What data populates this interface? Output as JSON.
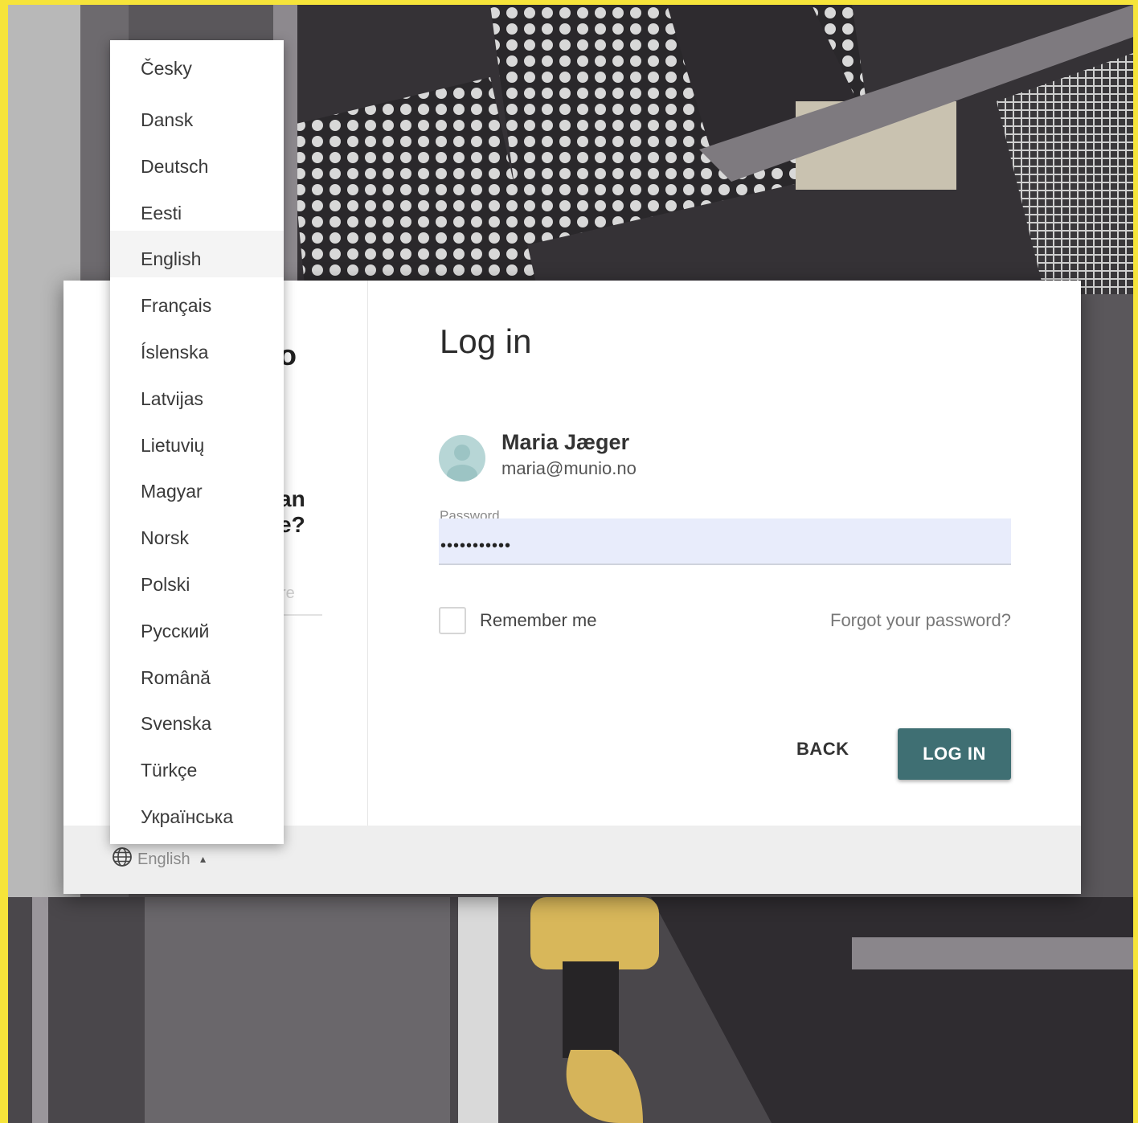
{
  "language_menu": {
    "items": [
      {
        "label": "Česky"
      },
      {
        "label": "Dansk"
      },
      {
        "label": "Deutsch"
      },
      {
        "label": "Eesti"
      },
      {
        "label": "English",
        "selected": true
      },
      {
        "label": "Français"
      },
      {
        "label": "Íslenska"
      },
      {
        "label": "Latvijas"
      },
      {
        "label": "Lietuvių"
      },
      {
        "label": "Magyar"
      },
      {
        "label": "Norsk"
      },
      {
        "label": "Polski"
      },
      {
        "label": "Русский"
      },
      {
        "label": "Română"
      },
      {
        "label": "Svenska"
      },
      {
        "label": "Türkçe"
      },
      {
        "label": "Українська"
      }
    ]
  },
  "footer": {
    "language_selector": {
      "current": "English",
      "icon": "globe-icon",
      "caret_icon": "caret-up-icon"
    }
  },
  "left_pane": {
    "fragment_1": "o",
    "fragment_2": "an",
    "fragment_3": "e?",
    "fragment_4": "re"
  },
  "login": {
    "title": "Log in",
    "user": {
      "name": "Maria Jæger",
      "email": "maria@munio.no",
      "avatar_icon": "user-avatar-icon"
    },
    "password": {
      "label": "Password",
      "value": "•••••••••••"
    },
    "remember_label": "Remember me",
    "forgot_label": "Forgot your password?",
    "back_label": "BACK",
    "login_label": "LOG IN"
  },
  "colors": {
    "accent": "#3f6f73",
    "frame": "#f6e43a",
    "input_bg": "#e8ecfb"
  }
}
